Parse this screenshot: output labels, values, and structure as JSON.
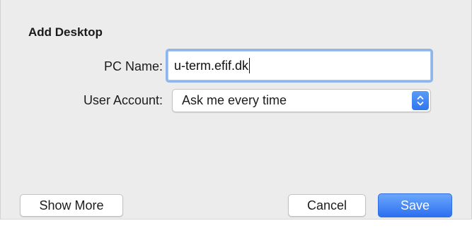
{
  "dialog": {
    "title": "Add Desktop"
  },
  "form": {
    "pc_name": {
      "label": "PC Name:",
      "value": "u-term.efif.dk"
    },
    "user_account": {
      "label": "User Account:",
      "selected": "Ask me every time"
    }
  },
  "buttons": {
    "show_more": "Show More",
    "cancel": "Cancel",
    "save": "Save"
  },
  "colors": {
    "accent": "#3478f6",
    "focus_ring": "#8db7ec",
    "sheet_background": "#ececec"
  },
  "icons": {
    "popup_indicator": "chevron-up-down-icon"
  }
}
